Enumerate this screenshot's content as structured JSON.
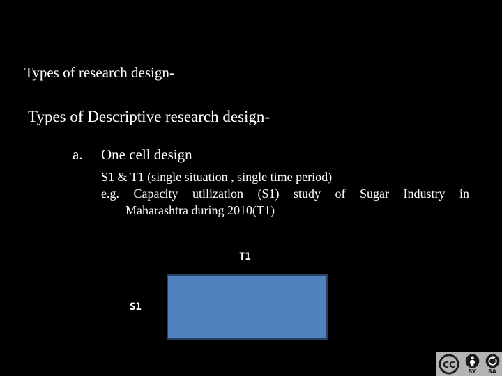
{
  "slide": {
    "background_color": "#000000",
    "text_color": "#ffffff",
    "heading_1": "Types of research design-",
    "heading_2": "Types of Descriptive research design-"
  },
  "list": {
    "marker": "a.",
    "label": "One cell design",
    "sub_lines": [
      "S1 & T1 (single situation , single time period)",
      "e.g.  Capacity  utilization  (S1)  study  of  Sugar  Industry  in",
      "Maharashtra  during 2010(T1)"
    ]
  },
  "diagram": {
    "column_label": "T1",
    "row_label": "S1",
    "cell_fill_color": "#4f81bd",
    "cell_border_color": "#254061"
  },
  "license_badge": {
    "mark": "CC",
    "background_color": "#b3b3b3",
    "items": [
      {
        "icon": "attribution-person-icon",
        "label": "BY"
      },
      {
        "icon": "share-alike-arrow-icon",
        "label": "SA"
      }
    ]
  }
}
